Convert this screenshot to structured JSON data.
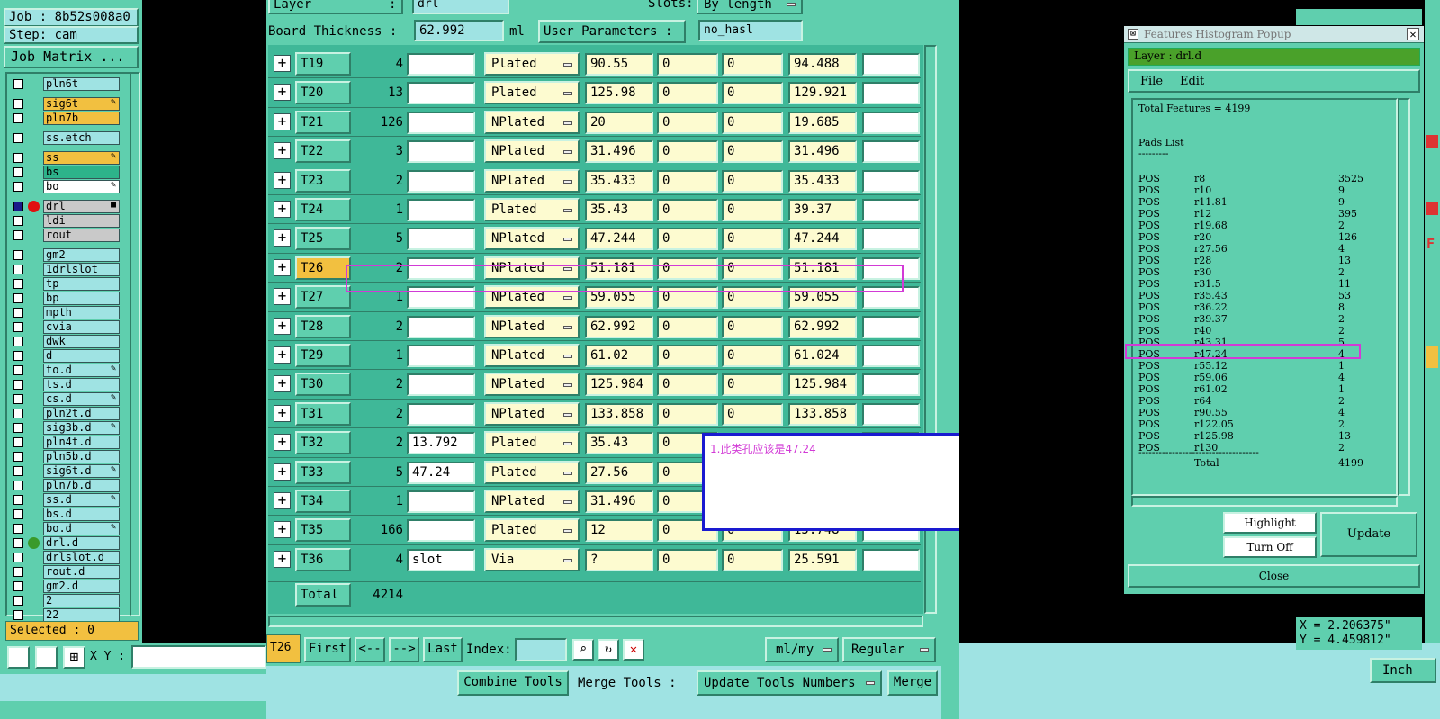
{
  "job": {
    "job_label": "Job : 8b52s008a0",
    "step_label": "Step: cam",
    "matrix_button": "Job Matrix ...",
    "selected": "Selected : 0",
    "xy_label": "X Y :"
  },
  "layers": [
    {
      "name": "pln6t",
      "color": "#9fe3e3",
      "mark": ""
    },
    {
      "name": "sig6t",
      "color": "#f2c040",
      "mark": "✎"
    },
    {
      "name": "pln7b",
      "color": "#f2c040",
      "mark": ""
    },
    {
      "name": "ss.etch",
      "color": "#9fe3e3",
      "mark": ""
    },
    {
      "name": "ss",
      "color": "#f2c040",
      "mark": "✎"
    },
    {
      "name": "bs",
      "color": "#2db38a",
      "mark": ""
    },
    {
      "name": "bo",
      "color": "#ffffff",
      "mark": "✎"
    },
    {
      "name": "drl",
      "color": "#c9c9c9",
      "mark": "■"
    },
    {
      "name": "ldi",
      "color": "#c9c9c9",
      "mark": ""
    },
    {
      "name": "rout",
      "color": "#c9c9c9",
      "mark": ""
    },
    {
      "name": "gm2",
      "color": "#9fe3e3",
      "mark": ""
    },
    {
      "name": "1drlslot",
      "color": "#9fe3e3",
      "mark": ""
    },
    {
      "name": "tp",
      "color": "#9fe3e3",
      "mark": ""
    },
    {
      "name": "bp",
      "color": "#9fe3e3",
      "mark": ""
    },
    {
      "name": "mpth",
      "color": "#9fe3e3",
      "mark": ""
    },
    {
      "name": "cvia",
      "color": "#9fe3e3",
      "mark": ""
    },
    {
      "name": "dwk",
      "color": "#9fe3e3",
      "mark": ""
    },
    {
      "name": "d",
      "color": "#9fe3e3",
      "mark": ""
    },
    {
      "name": "to.d",
      "color": "#9fe3e3",
      "mark": "✎"
    },
    {
      "name": "ts.d",
      "color": "#9fe3e3",
      "mark": ""
    },
    {
      "name": "cs.d",
      "color": "#9fe3e3",
      "mark": "✎"
    },
    {
      "name": "pln2t.d",
      "color": "#9fe3e3",
      "mark": ""
    },
    {
      "name": "sig3b.d",
      "color": "#9fe3e3",
      "mark": "✎"
    },
    {
      "name": "pln4t.d",
      "color": "#9fe3e3",
      "mark": ""
    },
    {
      "name": "pln5b.d",
      "color": "#9fe3e3",
      "mark": ""
    },
    {
      "name": "sig6t.d",
      "color": "#9fe3e3",
      "mark": "✎"
    },
    {
      "name": "pln7b.d",
      "color": "#9fe3e3",
      "mark": ""
    },
    {
      "name": "ss.d",
      "color": "#9fe3e3",
      "mark": "✎"
    },
    {
      "name": "bs.d",
      "color": "#9fe3e3",
      "mark": ""
    },
    {
      "name": "bo.d",
      "color": "#9fe3e3",
      "mark": "✎"
    },
    {
      "name": "drl.d",
      "color": "#9fe3e3",
      "mark": ""
    },
    {
      "name": "drlslot.d",
      "color": "#9fe3e3",
      "mark": ""
    },
    {
      "name": "rout.d",
      "color": "#9fe3e3",
      "mark": ""
    },
    {
      "name": "gm2.d",
      "color": "#9fe3e3",
      "mark": ""
    },
    {
      "name": "2",
      "color": "#9fe3e3",
      "mark": ""
    },
    {
      "name": "22",
      "color": "#9fe3e3",
      "mark": ""
    }
  ],
  "header": {
    "layer_label": "Layer",
    "layer_colon": ":",
    "layer_value": "drl",
    "slots_label": "Slots:",
    "slots_value": "By length",
    "thickness_label": "Board Thickness :",
    "thickness_value": "62.992",
    "thickness_unit": "ml",
    "user_params_label": "User Parameters :",
    "user_params_value": "no_hasl"
  },
  "tools": [
    {
      "name": "T19",
      "count": "4",
      "c1": "",
      "type": "Plated",
      "v1": "90.55",
      "v2": "0",
      "v3": "0",
      "v4": "94.488"
    },
    {
      "name": "T20",
      "count": "13",
      "c1": "",
      "type": "Plated",
      "v1": "125.98",
      "v2": "0",
      "v3": "0",
      "v4": "129.921"
    },
    {
      "name": "T21",
      "count": "126",
      "c1": "",
      "type": "NPlated",
      "v1": "20",
      "v2": "0",
      "v3": "0",
      "v4": "19.685"
    },
    {
      "name": "T22",
      "count": "3",
      "c1": "",
      "type": "NPlated",
      "v1": "31.496",
      "v2": "0",
      "v3": "0",
      "v4": "31.496"
    },
    {
      "name": "T23",
      "count": "2",
      "c1": "",
      "type": "NPlated",
      "v1": "35.433",
      "v2": "0",
      "v3": "0",
      "v4": "35.433"
    },
    {
      "name": "T24",
      "count": "1",
      "c1": "",
      "type": "Plated",
      "v1": "35.43",
      "v2": "0",
      "v3": "0",
      "v4": "39.37"
    },
    {
      "name": "T25",
      "count": "5",
      "c1": "",
      "type": "NPlated",
      "v1": "47.244",
      "v2": "0",
      "v3": "0",
      "v4": "47.244"
    },
    {
      "name": "T26",
      "count": "2",
      "c1": "",
      "type": "NPlated",
      "v1": "51.181",
      "v2": "0",
      "v3": "0",
      "v4": "51.181"
    },
    {
      "name": "T27",
      "count": "1",
      "c1": "",
      "type": "NPlated",
      "v1": "59.055",
      "v2": "0",
      "v3": "0",
      "v4": "59.055"
    },
    {
      "name": "T28",
      "count": "2",
      "c1": "",
      "type": "NPlated",
      "v1": "62.992",
      "v2": "0",
      "v3": "0",
      "v4": "62.992"
    },
    {
      "name": "T29",
      "count": "1",
      "c1": "",
      "type": "NPlated",
      "v1": "61.02",
      "v2": "0",
      "v3": "0",
      "v4": "61.024"
    },
    {
      "name": "T30",
      "count": "2",
      "c1": "",
      "type": "NPlated",
      "v1": "125.984",
      "v2": "0",
      "v3": "0",
      "v4": "125.984"
    },
    {
      "name": "T31",
      "count": "2",
      "c1": "",
      "type": "NPlated",
      "v1": "133.858",
      "v2": "0",
      "v3": "0",
      "v4": "133.858"
    },
    {
      "name": "T32",
      "count": "2",
      "c1": "13.792",
      "type": "Plated",
      "v1": "35.43",
      "v2": "0",
      "v3": "",
      "v4": ""
    },
    {
      "name": "T33",
      "count": "5",
      "c1": "47.24",
      "type": "Plated",
      "v1": "27.56",
      "v2": "0",
      "v3": "",
      "v4": ""
    },
    {
      "name": "T34",
      "count": "1",
      "c1": "",
      "type": "NPlated",
      "v1": "31.496",
      "v2": "0",
      "v3": "",
      "v4": ""
    },
    {
      "name": "T35",
      "count": "166",
      "c1": "",
      "type": "Plated",
      "v1": "12",
      "v2": "0",
      "v3": "0",
      "v4": "15.748"
    },
    {
      "name": "T36",
      "count": "4",
      "c1": "slot",
      "type": "Via",
      "v1": "?",
      "v2": "0",
      "v3": "0",
      "v4": "25.591"
    }
  ],
  "total": {
    "label": "Total",
    "value": "4214"
  },
  "nav": {
    "current_tool": "T26",
    "first": "First",
    "prev": "<--",
    "next": "-->",
    "last": "Last",
    "index_label": "Index:",
    "units": "ml/my",
    "mode": "Regular"
  },
  "bottom": {
    "combine": "Combine Tools",
    "merge_label": "Merge Tools :",
    "update_numbers": "Update Tools Numbers",
    "merge": "Merge"
  },
  "note": {
    "text": "1.此类孔应该是47.24"
  },
  "histogram": {
    "title": "Features Histogram Popup",
    "layer_label": "Layer :",
    "layer_value": "drl.d",
    "menu_file": "File",
    "menu_edit": "Edit",
    "total_features": "Total Features = 4199",
    "pads_list": "Pads List",
    "pads_underline": "---------",
    "rows": [
      {
        "pol": "POS",
        "sym": "r8",
        "cnt": "3525"
      },
      {
        "pol": "POS",
        "sym": "r10",
        "cnt": "9"
      },
      {
        "pol": "POS",
        "sym": "r11.81",
        "cnt": "9"
      },
      {
        "pol": "POS",
        "sym": "r12",
        "cnt": "395"
      },
      {
        "pol": "POS",
        "sym": "r19.68",
        "cnt": "2"
      },
      {
        "pol": "POS",
        "sym": "r20",
        "cnt": "126"
      },
      {
        "pol": "POS",
        "sym": "r27.56",
        "cnt": "4"
      },
      {
        "pol": "POS",
        "sym": "r28",
        "cnt": "13"
      },
      {
        "pol": "POS",
        "sym": "r30",
        "cnt": "2"
      },
      {
        "pol": "POS",
        "sym": "r31.5",
        "cnt": "11"
      },
      {
        "pol": "POS",
        "sym": "r35.43",
        "cnt": "53"
      },
      {
        "pol": "POS",
        "sym": "r36.22",
        "cnt": "8"
      },
      {
        "pol": "POS",
        "sym": "r39.37",
        "cnt": "2"
      },
      {
        "pol": "POS",
        "sym": "r40",
        "cnt": "2"
      },
      {
        "pol": "POS",
        "sym": "r43.31",
        "cnt": "5"
      },
      {
        "pol": "POS",
        "sym": "r47.24",
        "cnt": "4"
      },
      {
        "pol": "POS",
        "sym": "r55.12",
        "cnt": "1"
      },
      {
        "pol": "POS",
        "sym": "r59.06",
        "cnt": "4"
      },
      {
        "pol": "POS",
        "sym": "r61.02",
        "cnt": "1"
      },
      {
        "pol": "POS",
        "sym": "r64",
        "cnt": "2"
      },
      {
        "pol": "POS",
        "sym": "r90.55",
        "cnt": "4"
      },
      {
        "pol": "POS",
        "sym": "r122.05",
        "cnt": "2"
      },
      {
        "pol": "POS",
        "sym": "r125.98",
        "cnt": "13"
      },
      {
        "pol": "POS",
        "sym": "r130",
        "cnt": "2"
      }
    ],
    "dash_line": "------------------------------------",
    "total_label": "Total",
    "total_value": "4199",
    "highlight": "Highlight",
    "turn_off": "Turn Off",
    "update": "Update",
    "close": "Close"
  },
  "coords": {
    "x": "X = 2.206375\"",
    "y": "Y = 4.459812\""
  },
  "units_button": "Inch"
}
